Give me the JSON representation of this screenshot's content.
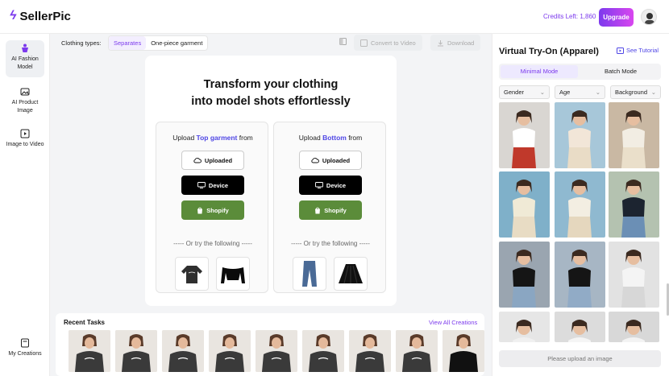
{
  "app": {
    "logo_text": "SellerPic",
    "credits": "Credits Left: 1,860",
    "upgrade_label": "Upgrade"
  },
  "nav": {
    "items": [
      {
        "label": "AI Fashion Model",
        "icon": "fashion-model-icon",
        "active": true
      },
      {
        "label": "AI Product Image",
        "icon": "image-icon"
      },
      {
        "label": "Image to Video",
        "icon": "video-icon"
      },
      {
        "label": "My Creations",
        "icon": "folder-icon"
      }
    ]
  },
  "toolbar": {
    "clothing_types_label": "Clothing types:",
    "types": [
      "Separates",
      "One-piece garment"
    ],
    "convert_label": "Convert to Video",
    "download_label": "Download"
  },
  "upload": {
    "headline_1": "Transform your clothing",
    "headline_2": "into model shots effortlessly",
    "top": {
      "prefix": "Upload ",
      "highlight": "Top garment",
      "suffix": " from"
    },
    "bottom": {
      "prefix": "Upload ",
      "highlight": "Bottom",
      "suffix": " from"
    },
    "btn_uploaded": "Uploaded",
    "btn_device": "Device",
    "btn_shopify": "Shopify",
    "or_text": "----- Or try the following -----"
  },
  "recent": {
    "title": "Recent Tasks",
    "link": "View All Creations"
  },
  "right": {
    "title": "Virtual Try-On (Apparel)",
    "tutorial": "See Tutorial",
    "modes": [
      "Minimal Mode",
      "Batch Mode"
    ],
    "filters": [
      "Gender",
      "Age",
      "Background"
    ],
    "hint": "Please upload an image"
  },
  "colors": {
    "accent": "#7c3aed",
    "shopify": "#5b8c3a"
  }
}
